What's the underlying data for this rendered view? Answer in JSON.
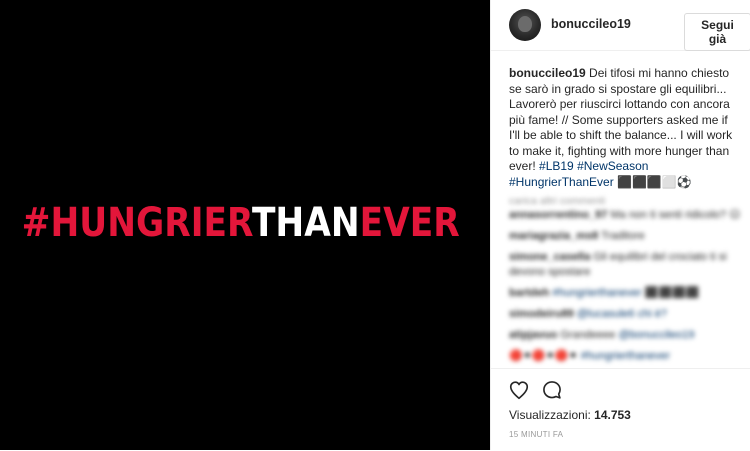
{
  "media": {
    "part1": "#HUNGRIER",
    "part2": "THAN",
    "part3": "EVER"
  },
  "header": {
    "username": "bonuccileo19",
    "follow_label": "Segui già"
  },
  "caption": {
    "username": "bonuccileo19",
    "text": " Dei tifosi mi hanno chiesto se sarò in grado si spostare gli equilibri... Lavorerò per riuscirci lottando con ancora più fame! // Some supporters asked me if I'll be able to shift the balance... I will work to make it, fighting with more hunger than ever! ",
    "tag1": "#LB19",
    "tag2": "#NewSeason",
    "tag3": "#HungrierThanEver",
    "emoji": " ⬛⬛⬛⬜⚽"
  },
  "load_more": "carica altri commenti",
  "comments": [
    {
      "user": "annasorrentino_97",
      "text": " Ma non ti senti ridicolo? 😐"
    },
    {
      "user": "mariagrazia_ms8",
      "text": " Traditore"
    },
    {
      "user": "simone_casella",
      "text": " Gli equilibri del crociato ti si devono spostare"
    },
    {
      "user": "bartdeh",
      "text": " ",
      "tag": "#hungrierthanever ⬛⬛⬛⬛"
    },
    {
      "user": "simodeiru89",
      "text": " ",
      "tag": "@lucasule6 chi è?"
    },
    {
      "user": "atipjavuo",
      "text": " Grandeeee ",
      "tag": "@bonuccileo19"
    },
    {
      "user": "",
      "text": "🔴⚫🔴⚫🔴⚫ ",
      "tag": "#hungrierthanever"
    }
  ],
  "actions": {
    "like_icon": "heart-icon",
    "comment_icon": "speech-bubble-icon"
  },
  "views_label": "Visualizzazioni: ",
  "views_count": "14.753",
  "timestamp": "15 MINUTI FA",
  "colors": {
    "red": "#e3163a",
    "link": "#003569",
    "muted": "#999999"
  }
}
